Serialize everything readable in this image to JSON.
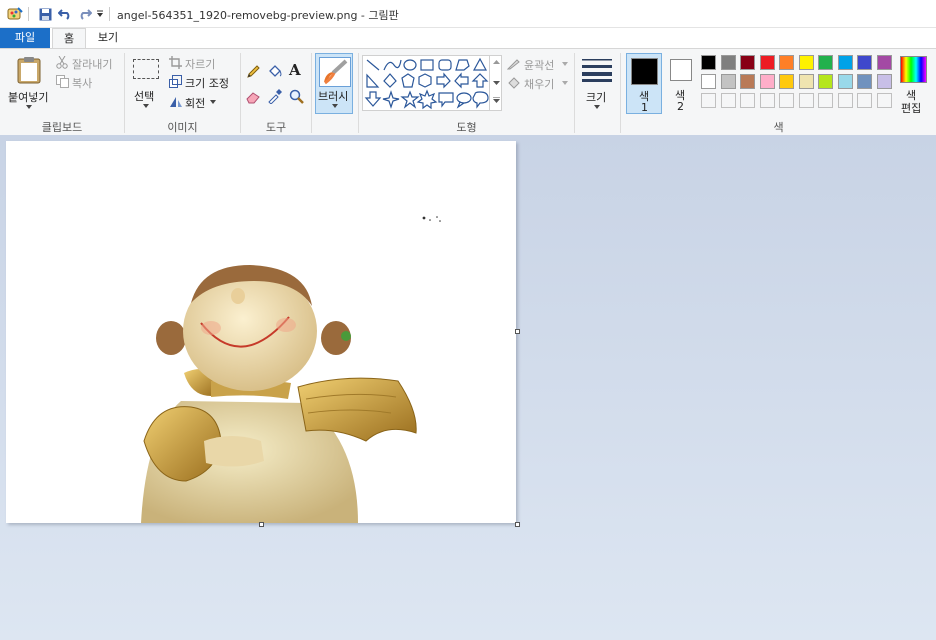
{
  "window": {
    "title": "angel-564351_1920-removebg-preview.png - 그림판"
  },
  "tabs": {
    "file": "파일",
    "home": "홈",
    "view": "보기"
  },
  "clipboard": {
    "paste": "붙여넣기",
    "cut": "잘라내기",
    "copy": "복사",
    "label": "클립보드"
  },
  "image": {
    "select": "선택",
    "crop": "자르기",
    "resize": "크기 조정",
    "rotate": "회전",
    "label": "이미지"
  },
  "tools": {
    "label": "도구"
  },
  "brushes": {
    "label": "브러시"
  },
  "shapes": {
    "outline": "윤곽선",
    "fill": "채우기",
    "label": "도형"
  },
  "size": {
    "label": "크기"
  },
  "colors": {
    "color1": "색",
    "color1_num": "1",
    "color2": "색",
    "color2_num": "2",
    "edit": "색",
    "edit2": "편집",
    "label": "색",
    "selected1": "#000000",
    "selected2": "#ffffff",
    "palette_row1": [
      "#000000",
      "#7f7f7f",
      "#880015",
      "#ed1c24",
      "#ff7f27",
      "#fff200",
      "#22b14c",
      "#00a2e8",
      "#3f48cc",
      "#a349a4"
    ],
    "palette_row2": [
      "#ffffff",
      "#c3c3c3",
      "#b97a57",
      "#ffaec9",
      "#ffc90e",
      "#efe4b0",
      "#b5e61d",
      "#99d9ea",
      "#7092be",
      "#c8bfe7"
    ]
  }
}
